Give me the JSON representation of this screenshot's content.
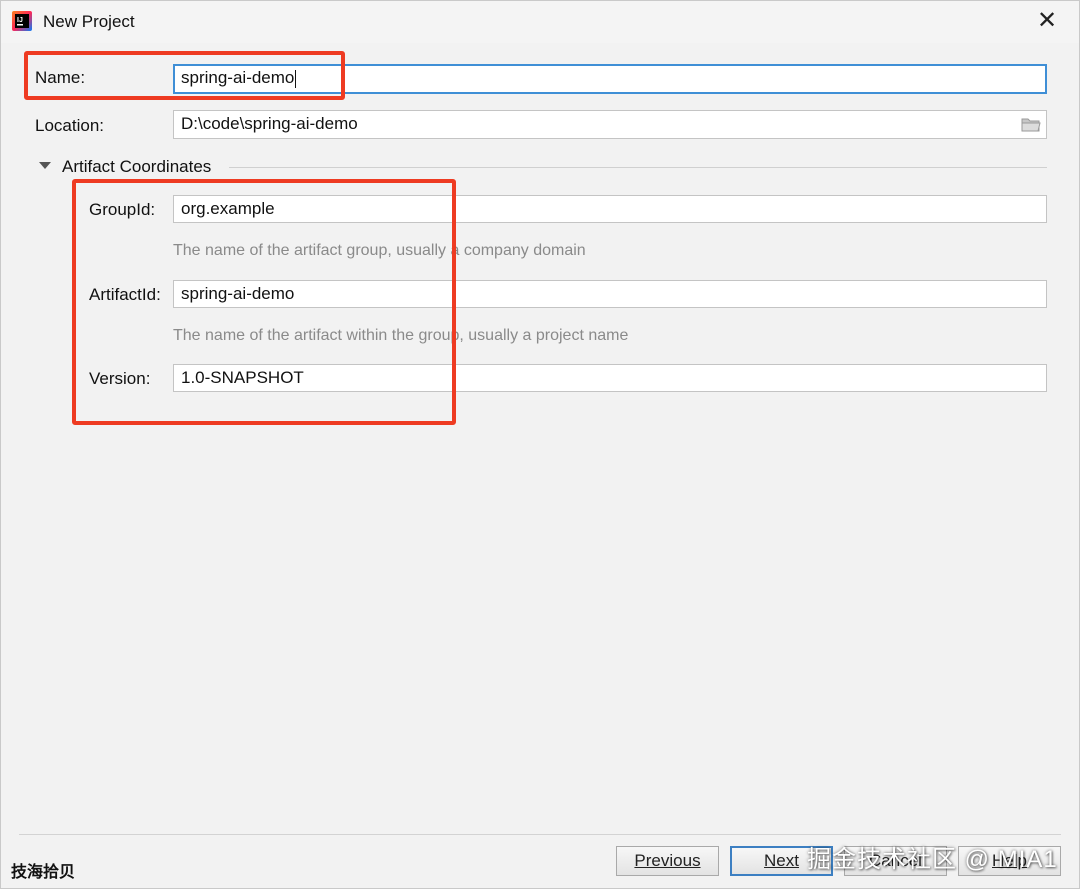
{
  "window": {
    "title": "New Project",
    "close_icon": "close-icon",
    "app_icon": "intellij-idea-icon"
  },
  "form": {
    "name_label": "Name:",
    "name_value": "spring-ai-demo",
    "location_label": "Location:",
    "location_value": "D:\\code\\spring-ai-demo",
    "browse_icon": "folder-icon"
  },
  "artifact": {
    "section_title": "Artifact Coordinates",
    "expanded": true,
    "group_label": "GroupId:",
    "group_value": "org.example",
    "group_hint": "The name of the artifact group, usually a company domain",
    "artifact_label": "ArtifactId:",
    "artifact_value": "spring-ai-demo",
    "artifact_hint": "The name of the artifact within the group, usually a project name",
    "version_label": "Version:",
    "version_value": "1.0-SNAPSHOT"
  },
  "footer": {
    "previous": "Previous",
    "next": "Next",
    "cancel": "Cancel",
    "help": "Help"
  },
  "watermarks": {
    "left": "技海拾贝",
    "right": "掘金技术社区 @ MIA1"
  },
  "colors": {
    "highlight_box": "#ee3b22",
    "focus_border": "#3f8fd6"
  }
}
